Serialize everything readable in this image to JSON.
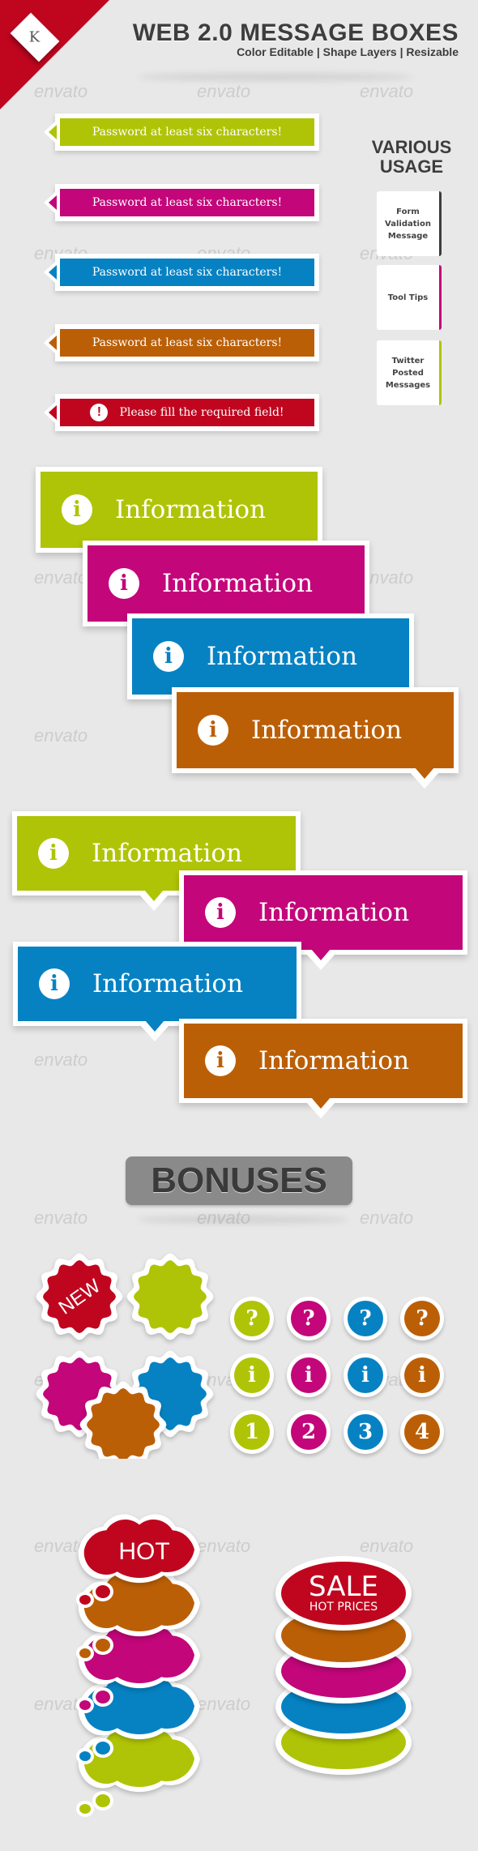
{
  "colors": {
    "green": "#afc406",
    "magenta": "#c3067a",
    "blue": "#0682c3",
    "orange": "#bb5f06",
    "red": "#c0061f",
    "dark": "#3d3d3d",
    "background": "#e8e8e8"
  },
  "header": {
    "logo_letter": "K",
    "title": "WEB 2.0 MESSAGE BOXES",
    "subtitle": "Color Editable | Shape Layers | Resizable"
  },
  "watermark": "envato",
  "validation_messages": [
    {
      "text": "Password at least six characters!",
      "color": "green",
      "icon": null
    },
    {
      "text": "Password at least six characters!",
      "color": "magenta",
      "icon": null
    },
    {
      "text": "Password at least six characters!",
      "color": "blue",
      "icon": null
    },
    {
      "text": "Password at least six characters!",
      "color": "orange",
      "icon": null
    },
    {
      "text": "Please fill the required field!",
      "color": "red",
      "icon": "exclamation-icon"
    }
  ],
  "exclamation_glyph": "!",
  "usage": {
    "title": "VARIOUS USAGE",
    "cards": [
      {
        "label": "Form Validation Message",
        "accent": "dark"
      },
      {
        "label": "Tool Tips",
        "accent": "magenta"
      },
      {
        "label": "Twitter Posted Messages",
        "accent": "green"
      }
    ]
  },
  "info_label": "Information",
  "info_glyph": "i",
  "info_boxes_stair": [
    {
      "label": "Information",
      "color": "green"
    },
    {
      "label": "Information",
      "color": "magenta"
    },
    {
      "label": "Information",
      "color": "blue"
    },
    {
      "label": "Information",
      "color": "orange"
    }
  ],
  "info_boxes_zigzag": [
    {
      "label": "Information",
      "color": "green"
    },
    {
      "label": "Information",
      "color": "magenta"
    },
    {
      "label": "Information",
      "color": "blue"
    },
    {
      "label": "Information",
      "color": "orange"
    }
  ],
  "bonuses": {
    "title": "BONUSES",
    "starburst_label": "NEW",
    "starbursts": [
      "red",
      "green",
      "magenta",
      "blue",
      "orange"
    ],
    "badge_rows": [
      {
        "glyphs": [
          "?",
          "?",
          "?",
          "?"
        ]
      },
      {
        "glyphs": [
          "i",
          "i",
          "i",
          "i"
        ]
      },
      {
        "glyphs": [
          "1",
          "2",
          "3",
          "4"
        ]
      }
    ],
    "badge_colors": [
      "green",
      "magenta",
      "blue",
      "orange"
    ],
    "thought_label": "HOT",
    "thought_colors": [
      "red",
      "orange",
      "magenta",
      "blue",
      "green"
    ],
    "sale_title": "SALE",
    "sale_subtitle": "HOT PRICES",
    "ellipse_colors": [
      "red",
      "orange",
      "magenta",
      "blue",
      "green"
    ]
  }
}
